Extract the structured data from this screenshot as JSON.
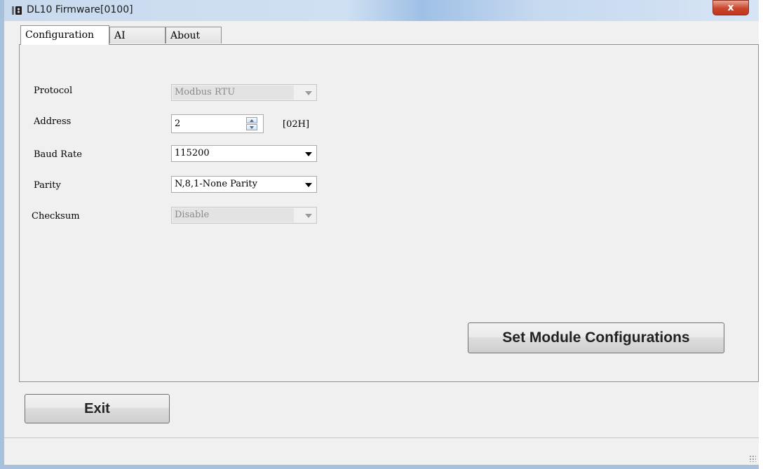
{
  "window": {
    "title": "DL10 Firmware[0100]",
    "close_glyph": "x",
    "app_icon": "app-icon"
  },
  "tabs": [
    {
      "label": "Configuration",
      "active": true
    },
    {
      "label": "AI",
      "active": false
    },
    {
      "label": "About",
      "active": false
    }
  ],
  "config": {
    "protocol": {
      "label": "Protocol",
      "value": "Modbus RTU",
      "enabled": false
    },
    "address": {
      "label": "Address",
      "value": "2",
      "hex": "[02H]"
    },
    "baud_rate": {
      "label": "Baud Rate",
      "value": "115200",
      "enabled": true
    },
    "parity": {
      "label": "Parity",
      "value": "N,8,1-None Parity",
      "enabled": true
    },
    "checksum": {
      "label": "Checksum",
      "value": "Disable",
      "enabled": false
    },
    "set_button": "Set Module Configurations"
  },
  "footer": {
    "exit_button": "Exit"
  }
}
